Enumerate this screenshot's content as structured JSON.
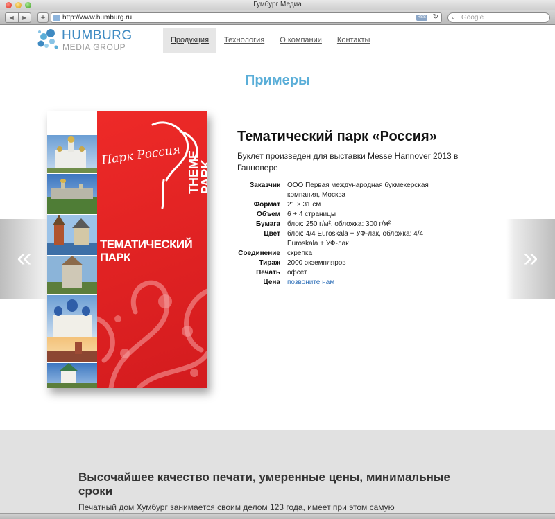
{
  "browser": {
    "window_title": "Гумбург Медиа",
    "url": "http://www.humburg.ru",
    "rss_label": "RSS",
    "search_placeholder": "Google",
    "nav_back": "◀",
    "nav_forward": "▶",
    "add_label": "+",
    "reload_glyph": "↻",
    "search_glyph": "⌕"
  },
  "site": {
    "logo_top": "HUMBURG",
    "logo_bottom": "MEDIA GROUP",
    "nav": [
      {
        "label": "Продукция"
      },
      {
        "label": "Технология"
      },
      {
        "label": "О компании"
      },
      {
        "label": "Контакты"
      }
    ]
  },
  "main": {
    "section_title": "Примеры",
    "prev_glyph": "«",
    "next_glyph": "»"
  },
  "booklet": {
    "script_title": "Парк Россия",
    "theme_line1": "THEME",
    "theme_line2": "PARK",
    "title_line1": "ТЕМАТИЧЕСКИЙ",
    "title_line2": "ПАРК"
  },
  "product": {
    "title": "Тематический парк «Россия»",
    "description": "Буклет произведен для выставки Messe Hannover 2013 в Ганновере",
    "specs": [
      {
        "label": "Заказчик",
        "value": "ООО Первая международная букмекерская компания, Москва"
      },
      {
        "label": "Формат",
        "value": "21 × 31 см"
      },
      {
        "label": "Объем",
        "value": "6 + 4 страницы"
      },
      {
        "label": "Бумага",
        "value": "блок: 250 г/м², обложка: 300 г/м²"
      },
      {
        "label": "Цвет",
        "value": "блок: 4/4 Euroskala + УФ-лак, обложка: 4/4 Euroskala + УФ-лак"
      },
      {
        "label": "Соединение",
        "value": "скрепка"
      },
      {
        "label": "Тираж",
        "value": "2000 экземпляров"
      },
      {
        "label": "Печать",
        "value": "офсет"
      },
      {
        "label": "Цена",
        "value": "позвоните нам"
      }
    ]
  },
  "band": {
    "heading": "Высочайшее качество печати, умеренные цены, минимальные сроки",
    "text": "Печатный дом Хумбург занимается своим делом 123 года, имеет при этом самую"
  },
  "colors": {
    "accent_blue": "#5aaed8",
    "logo_blue": "#3e8ac2",
    "booklet_red": "#e0201f",
    "link": "#2f70b8",
    "band_gray": "#e1e1e1"
  }
}
